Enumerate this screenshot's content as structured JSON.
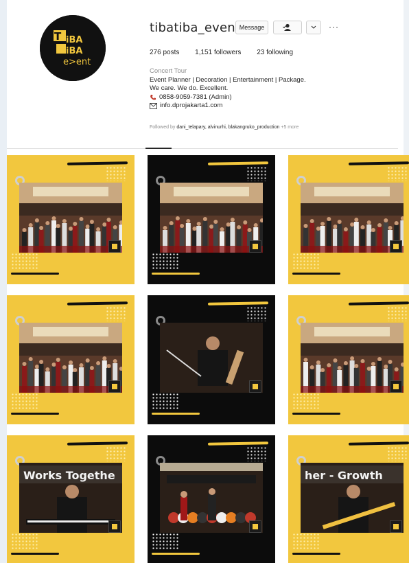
{
  "profile": {
    "username": "tibatiba_event",
    "logo_text": [
      "TiBA",
      "iBA",
      "e>ent"
    ],
    "buttons": {
      "message": "Message",
      "follow_icon": "user-check-icon",
      "dropdown_icon": "chevron-down-icon",
      "more": "···"
    },
    "stats": {
      "posts": "276 posts",
      "followers": "1,151 followers",
      "following": "23 following"
    },
    "bio": {
      "category": "Concert Tour",
      "line1": "Event Planner | Decoration | Entertainment | Package.",
      "line2": "We care. We do. Excellent.",
      "phone": "0858-9059-7381 (Admin)",
      "phone_icon": "phone-icon",
      "email": "info.dprojakarta1.com",
      "email_icon": "mail-icon"
    },
    "followed_by_prefix": "Followed by",
    "followed_by_names": "dani_telapary, alvinurhi, blakangruko_production",
    "followed_by_more": "+5 more"
  },
  "colors": {
    "brand_yellow": "#f2c73e",
    "black": "#0c0c0c"
  },
  "posts": [
    {
      "frame": "yellow",
      "scene": "ballroom crowd dancing"
    },
    {
      "frame": "black",
      "scene": "ballroom crowd dancing"
    },
    {
      "frame": "yellow",
      "scene": "ballroom crowd seated"
    },
    {
      "frame": "yellow",
      "scene": "ballroom crowd dancing"
    },
    {
      "frame": "black",
      "scene": "drummer performing"
    },
    {
      "frame": "yellow",
      "scene": "ballroom crowd seated"
    },
    {
      "frame": "yellow",
      "scene": "keyboard player on stage",
      "banner": "Works Togethe"
    },
    {
      "frame": "black",
      "scene": "band on stage"
    },
    {
      "frame": "yellow",
      "scene": "bass guitarist on stage",
      "banner": "her - Growth"
    }
  ]
}
